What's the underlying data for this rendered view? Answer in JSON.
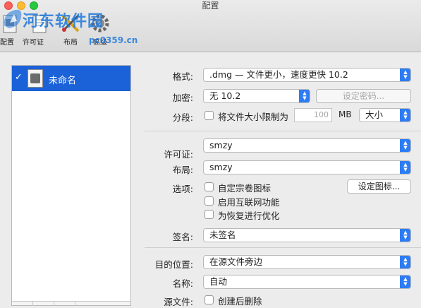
{
  "window": {
    "title": "配置"
  },
  "toolbar": {
    "items": [
      {
        "label": "配置",
        "icon": "config-icon"
      },
      {
        "label": "许可证",
        "icon": "license-icon"
      },
      {
        "label": "布局",
        "icon": "layout-icon"
      },
      {
        "label": "高级",
        "icon": "gear-icon"
      }
    ]
  },
  "watermark": {
    "text": "河东软件园",
    "url": "pc0359.cn"
  },
  "sidebar": {
    "items": [
      {
        "label": "未命名",
        "checked": true,
        "selected": true
      }
    ]
  },
  "form": {
    "format": {
      "label": "格式:",
      "value": ".dmg — 文件更小，速度更快 10.2"
    },
    "encryption": {
      "label": "加密:",
      "value": "无 10.2",
      "button": "设定密码..."
    },
    "segment": {
      "label": "分段:",
      "checkbox_label": "将文件大小限制为",
      "size_placeholder": "100",
      "unit": "MB",
      "size_value": "大小"
    },
    "license": {
      "label": "许可证:",
      "value": "smzy"
    },
    "layout": {
      "label": "布局:",
      "value": "smzy"
    },
    "options": {
      "label": "选项:",
      "checkboxes": [
        "自定宗卷图标",
        "启用互联网功能",
        "为恢复进行优化"
      ],
      "button": "设定图标..."
    },
    "signature": {
      "label": "签名:",
      "value": "未签名"
    },
    "destination": {
      "label": "目的位置:",
      "value": "在源文件旁边"
    },
    "name": {
      "label": "名称:",
      "value": "自动"
    },
    "source": {
      "label": "源文件:",
      "checkbox_label": "创建后删除"
    }
  },
  "colors": {
    "accent": "#2d7cf6",
    "selection": "#1b62d9",
    "watermark": "#1e78dc"
  }
}
